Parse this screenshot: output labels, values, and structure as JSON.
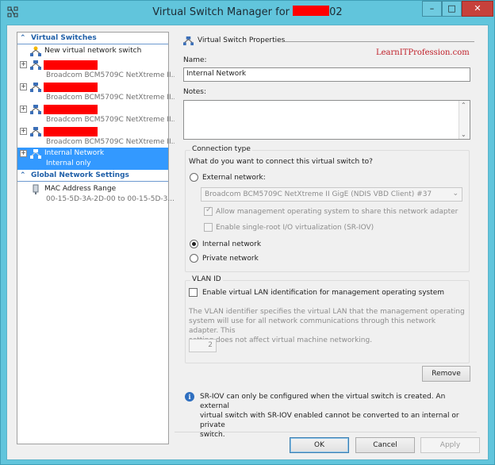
{
  "window": {
    "title": "Virtual Switch Manager for",
    "title_suffix": "02",
    "buttons": {
      "minimize": "–",
      "maximize": "□",
      "close": "✕"
    }
  },
  "watermark": "LearnITProfession.com",
  "tree": {
    "virtual_switches_header": "Virtual Switches",
    "new_switch_label": "New virtual network switch",
    "items": [
      {
        "sub": "Broadcom BCM5709C NetXtreme II..."
      },
      {
        "sub": "Broadcom BCM5709C NetXtreme II..."
      },
      {
        "sub": "Broadcom BCM5709C NetXtreme II..."
      },
      {
        "sub": "Broadcom BCM5709C NetXtreme II..."
      }
    ],
    "selected_item": {
      "label": "Internal Network",
      "sub": "Internal only"
    },
    "global_header": "Global Network Settings",
    "mac_label": "MAC Address Range",
    "mac_sub": "00-15-5D-3A-2D-00 to 00-15-5D-3..."
  },
  "props": {
    "header": "Virtual Switch Properties",
    "name_label": "Name:",
    "name_value": "Internal Network",
    "notes_label": "Notes:",
    "connection_type": {
      "title": "Connection type",
      "question": "What do you want to connect this virtual switch to?",
      "external_label": "External network:",
      "adapter_value": "Broadcom BCM5709C NetXtreme II GigE (NDIS VBD Client) #37",
      "allow_mgmt_label": "Allow management operating system to share this network adapter",
      "sriov_label": "Enable single-root I/O virtualization (SR-IOV)",
      "internal_label": "Internal network",
      "private_label": "Private network",
      "selected": "Internal network"
    },
    "vlan": {
      "title": "VLAN ID",
      "enable_label": "Enable virtual LAN identification for management operating system",
      "description_lines": [
        "The VLAN identifier specifies the virtual LAN that the management operating",
        "system will use for all network communications through this network adapter. This",
        "setting does not affect virtual machine networking."
      ],
      "vlan_value": "2"
    },
    "remove_label": "Remove",
    "info_lines": [
      "SR-IOV can only be configured when the virtual switch is created. An external",
      "virtual switch with SR-IOV enabled cannot be converted to an internal or private",
      "switch."
    ]
  },
  "footer": {
    "ok": "OK",
    "cancel": "Cancel",
    "apply": "Apply"
  },
  "colors": {
    "titlebar": "#61c5dc",
    "selection": "#3399ff",
    "section_header": "#1f5fa8",
    "redaction": "#ff0000"
  }
}
